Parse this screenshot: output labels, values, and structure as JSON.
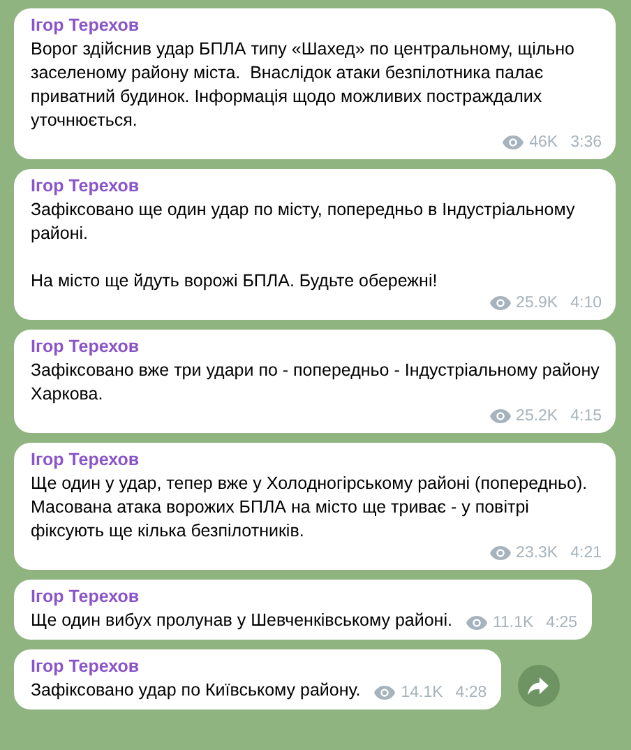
{
  "messages": [
    {
      "author": "Ігор Терехов",
      "text": "Ворог здійснив удар БПЛА типу «Шахед» по центральному, щільно заселеному району міста.  Внаслідок атаки безпілотника палає приватний будинок. Інформація щодо можливих постраждалих уточнюється.",
      "views": "46K",
      "time": "3:36",
      "forward_button": false
    },
    {
      "author": "Ігор Терехов",
      "text": "Зафіксовано ще один удар по місту, попередньо в Індустріальному районі.\n\nНа місто ще йдуть ворожі БПЛА. Будьте обережні!",
      "views": "25.9K",
      "time": "4:10",
      "forward_button": false
    },
    {
      "author": "Ігор Терехов",
      "text": "Зафіксовано вже три удари по - попередньо - Індустріальному району Харкова.",
      "views": "25.2K",
      "time": "4:15",
      "forward_button": false
    },
    {
      "author": "Ігор Терехов",
      "text": "Ще один у удар, тепер вже у Холодногірському районі (попередньо). Масована атака ворожих БПЛА на місто ще триває - у повітрі фіксують ще кілька безпілотників.",
      "views": "23.3K",
      "time": "4:21",
      "forward_button": false
    },
    {
      "author": "Ігор Терехов",
      "text": "Ще один вибух пролунав у Шевченківському районі.",
      "views": "11.1K",
      "time": "4:25",
      "forward_button": false
    },
    {
      "author": "Ігор Терехов",
      "text": "Зафіксовано удар по Київському району.",
      "views": "14.1K",
      "time": "4:28",
      "forward_button": true
    }
  ]
}
